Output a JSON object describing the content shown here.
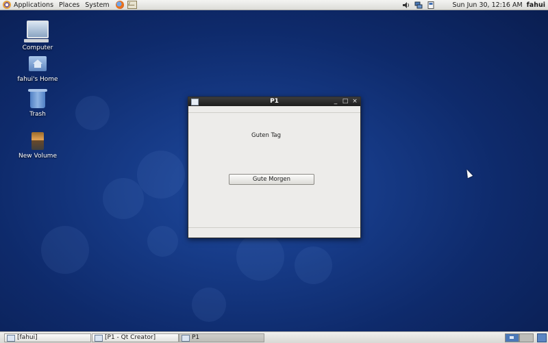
{
  "top_panel": {
    "menus": [
      "Applications",
      "Places",
      "System"
    ],
    "clock": "Sun Jun 30, 12:16 AM",
    "user": "fahui"
  },
  "desktop": {
    "icons": [
      {
        "label": "Computer",
        "icon": "computer-icon"
      },
      {
        "label": "fahui's Home",
        "icon": "home-folder-icon"
      },
      {
        "label": "Trash",
        "icon": "trash-icon"
      },
      {
        "label": "New Volume",
        "icon": "volume-icon"
      }
    ]
  },
  "window": {
    "title": "P1",
    "label": "Guten Tag",
    "button": "Gute Morgen",
    "controls": {
      "minimize": "_",
      "maximize": "□",
      "close": "×"
    }
  },
  "taskbar": {
    "tasks": [
      "[fahui]",
      "[P1 - Qt Creator]",
      "P1"
    ],
    "active_task": "P1"
  },
  "colors": {
    "desktop_bg": "#163a86",
    "titlebar": "#2a2a2a",
    "workspace_active": "#4a78b8"
  }
}
